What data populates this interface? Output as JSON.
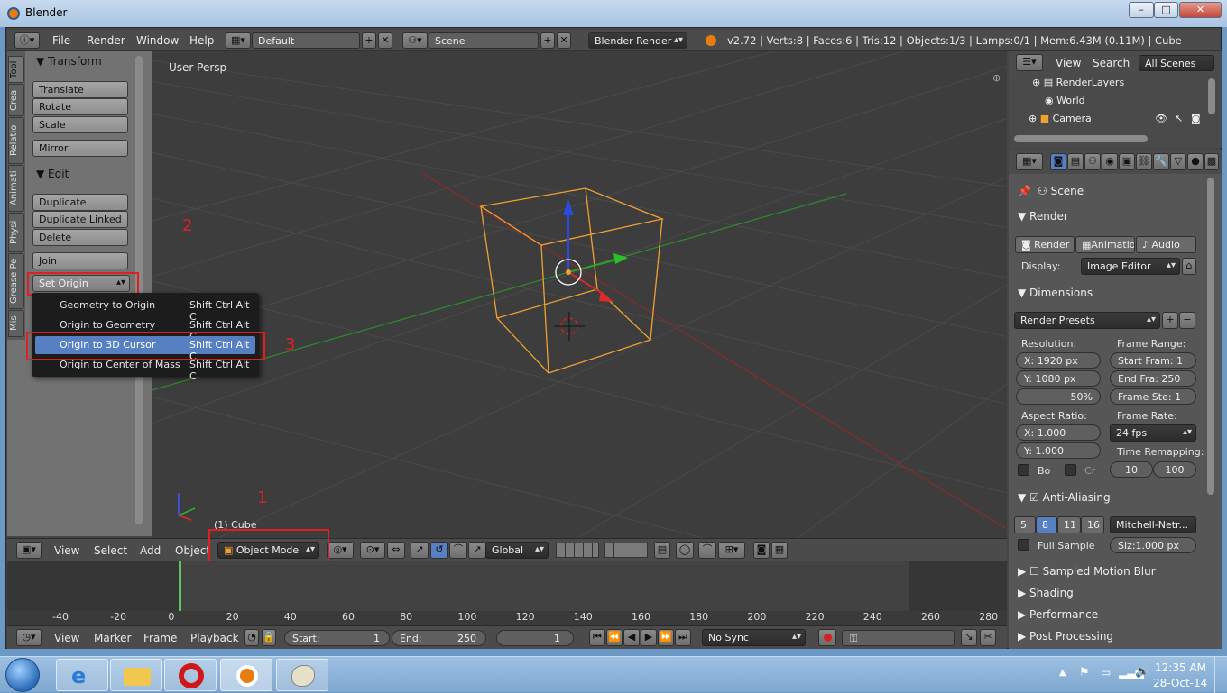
{
  "window": {
    "title": "Blender",
    "min": "–",
    "max": "□",
    "close": "✕"
  },
  "info": {
    "menus": [
      "File",
      "Render",
      "Window",
      "Help"
    ],
    "screen_layout": "Default",
    "scene": "Scene",
    "engine": "Blender Render",
    "stats": "v2.72 | Verts:8 | Faces:6 | Tris:12 | Objects:1/3 | Lamps:0/1 | Mem:6.43M (0.11M) | Cube"
  },
  "toolshelf": {
    "tabs": [
      "Tool",
      "Crea",
      "Relatio",
      "Animati",
      "Physi",
      "Grease Pe",
      "Mis"
    ],
    "transform_header": "Transform",
    "transform_buttons": [
      "Translate",
      "Rotate",
      "Scale",
      "Mirror"
    ],
    "edit_header": "Edit",
    "edit_buttons": [
      "Duplicate",
      "Duplicate Linked",
      "Delete",
      "Join"
    ],
    "set_origin": "Set Origin"
  },
  "popup": {
    "items": [
      {
        "label": "Geometry to Origin",
        "shortcut": "Shift Ctrl Alt C"
      },
      {
        "label": "Origin to Geometry",
        "shortcut": "Shift Ctrl Alt C"
      },
      {
        "label": "Origin to 3D Cursor",
        "shortcut": "Shift Ctrl Alt C"
      },
      {
        "label": "Origin to Center of Mass",
        "shortcut": "Shift Ctrl Alt C"
      }
    ],
    "selected_index": 2
  },
  "viewport": {
    "view_label": "User Persp",
    "object_label": "(1) Cube"
  },
  "annotations": {
    "one": "1",
    "two": "2",
    "three": "3"
  },
  "viewport_header": {
    "menus": [
      "View",
      "Select",
      "Add",
      "Object"
    ],
    "mode": "Object Mode",
    "orientation": "Global"
  },
  "timeline": {
    "ruler": [
      "-40",
      "-20",
      "0",
      "20",
      "40",
      "60",
      "80",
      "100",
      "120",
      "140",
      "160",
      "180",
      "200",
      "220",
      "240",
      "260",
      "280"
    ],
    "menus": [
      "View",
      "Marker",
      "Frame",
      "Playback"
    ],
    "start_label": "Start:",
    "start": "1",
    "end_label": "End:",
    "end": "250",
    "current": "1",
    "sync": "No Sync"
  },
  "outliner": {
    "menus": [
      "View",
      "Search"
    ],
    "filter": "All Scenes",
    "items": [
      "RenderLayers",
      "World",
      "Camera"
    ]
  },
  "properties": {
    "context": "Scene",
    "render_header": "Render",
    "render_buttons": [
      "Render",
      "Animatio",
      "Audio"
    ],
    "display_label": "Display:",
    "display_value": "Image Editor",
    "dimensions_header": "Dimensions",
    "presets": "Render Presets",
    "resolution_label": "Resolution:",
    "res_x": "X:  1920 px",
    "res_y": "Y:  1080 px",
    "res_pct": "50%",
    "frame_range_label": "Frame Range:",
    "start_frame": "Start Fram: 1",
    "end_frame": "End Fra: 250",
    "frame_step": "Frame Ste: 1",
    "aspect_label": "Aspect Ratio:",
    "aspect_x": "X:   1.000",
    "aspect_y": "Y:   1.000",
    "frame_rate_label": "Frame Rate:",
    "fps": "24 fps",
    "time_remap_label": "Time Remapping:",
    "remap_old": "10",
    "remap_new": "100",
    "border": "Bo",
    "crop": "Cr",
    "aa_header": "Anti-Aliasing",
    "aa_samples": [
      "5",
      "8",
      "11",
      "16"
    ],
    "aa_filter": "Mitchell-Netr...",
    "full_sample": "Full Sample",
    "filter_size": "Siz:1.000 px",
    "collapsed": [
      "Sampled Motion Blur",
      "Shading",
      "Performance",
      "Post Processing"
    ]
  },
  "taskbar": {
    "time": "12:35 AM",
    "date": "28-Oct-14"
  }
}
